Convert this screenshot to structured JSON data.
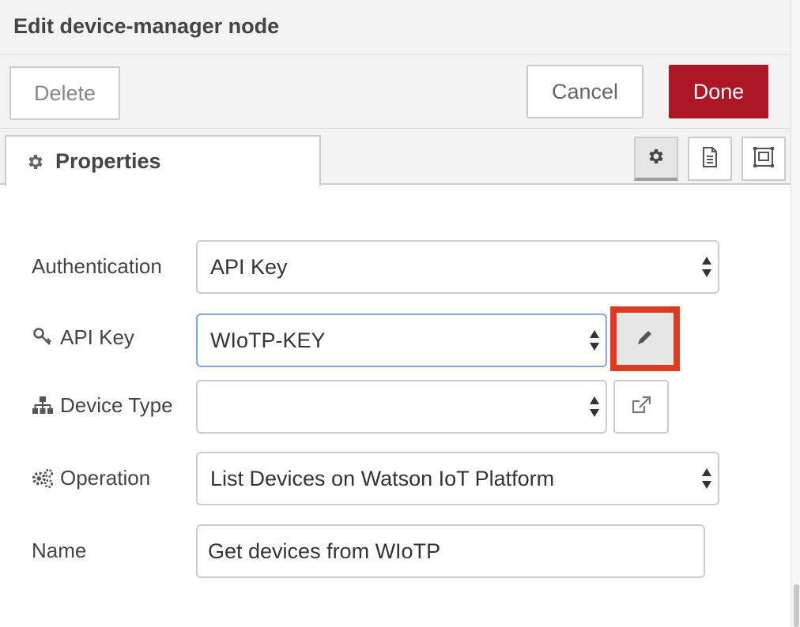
{
  "dialog": {
    "title": "Edit device-manager node"
  },
  "toolbar": {
    "delete_label": "Delete",
    "cancel_label": "Cancel",
    "done_label": "Done"
  },
  "tabs": {
    "properties_label": "Properties",
    "properties_icon": "gear-icon",
    "buttons": [
      "gear-icon",
      "document-icon",
      "layout-icon"
    ]
  },
  "form": {
    "authentication": {
      "label": "Authentication",
      "value": "API Key"
    },
    "api_key": {
      "label": "API Key",
      "icon": "key-icon",
      "value": "WIoTP-KEY",
      "edit_icon": "pencil-icon"
    },
    "device_type": {
      "label": "Device Type",
      "icon": "sitemap-icon",
      "value": "",
      "open_icon": "external-link-icon"
    },
    "operation": {
      "label": "Operation",
      "icon": "gears-icon",
      "value": "List Devices on Watson IoT Platform"
    },
    "name": {
      "label": "Name",
      "value": "Get devices from WIoTP"
    }
  },
  "colors": {
    "done_bg": "#ad1625",
    "highlight": "#e23a22",
    "focus_border": "#85a6d6"
  }
}
